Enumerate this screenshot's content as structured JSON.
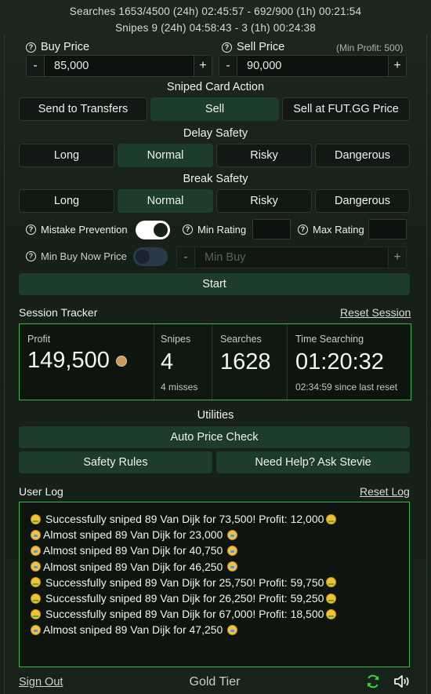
{
  "status": {
    "searches_line": "Searches  1653/4500 (24h) 02:45:57  -  692/900 (1h) 00:21:54",
    "snipes_line": "Snipes  9 (24h) 04:58:43  -  3 (1h) 00:24:38"
  },
  "buy": {
    "label": "Buy Price",
    "value": "85,000",
    "minus": "-",
    "plus": "+"
  },
  "sell": {
    "label": "Sell Price",
    "value": "90,000",
    "minus": "-",
    "plus": "+",
    "min_profit": "(Min Profit: 500)"
  },
  "sniped_action": {
    "title": "Sniped Card Action",
    "options": [
      "Send to Transfers",
      "Sell",
      "Sell at FUT.GG Price"
    ],
    "selected": "Sell"
  },
  "delay_safety": {
    "title": "Delay Safety",
    "options": [
      "Long",
      "Normal",
      "Risky",
      "Dangerous"
    ],
    "selected": "Normal"
  },
  "break_safety": {
    "title": "Break Safety",
    "options": [
      "Long",
      "Normal",
      "Risky",
      "Dangerous"
    ],
    "selected": "Normal"
  },
  "mistake_prevention": {
    "label": "Mistake Prevention",
    "enabled": true
  },
  "min_rating": {
    "label": "Min Rating",
    "value": ""
  },
  "max_rating": {
    "label": "Max Rating",
    "value": ""
  },
  "min_buy_now": {
    "label": "Min Buy Now Price",
    "enabled": false,
    "placeholder": "Min Buy",
    "minus": "-",
    "plus": "+"
  },
  "start_label": "Start",
  "session": {
    "title": "Session Tracker",
    "reset": "Reset Session",
    "profit_caption": "Profit",
    "profit_value": "149,500",
    "snipes_caption": "Snipes",
    "snipes_value": "4",
    "snipes_sub": "4 misses",
    "searches_caption": "Searches",
    "searches_value": "1628",
    "time_caption": "Time Searching",
    "time_value": "01:20:32",
    "time_sub": "02:34:59 since last reset"
  },
  "utilities": {
    "title": "Utilities",
    "auto_price": "Auto Price Check",
    "safety_rules": "Safety Rules",
    "help": "Need Help? Ask Stevie"
  },
  "user_log": {
    "title": "User Log",
    "reset": "Reset Log",
    "entries": [
      {
        "icon": "money-face-icon",
        "text": "Successfully sniped 89 Van Dijk for 73,500! Profit: 12,000",
        "trail": "money-face-icon"
      },
      {
        "icon": "sad-face-icon",
        "text": "Almost sniped 89 Van Dijk for 23,000",
        "trail": "sad-face-icon"
      },
      {
        "icon": "sad-face-icon",
        "text": "Almost sniped 89 Van Dijk for 40,750",
        "trail": "sad-face-icon"
      },
      {
        "icon": "sad-face-icon",
        "text": "Almost sniped 89 Van Dijk for 46,250",
        "trail": "sad-face-icon"
      },
      {
        "icon": "money-face-icon",
        "text": "Successfully sniped 89 Van Dijk for 25,750! Profit: 59,750",
        "trail": "money-face-icon"
      },
      {
        "icon": "money-face-icon",
        "text": "Successfully sniped 89 Van Dijk for 26,250! Profit: 59,250",
        "trail": "money-face-icon"
      },
      {
        "icon": "money-face-icon",
        "text": "Successfully sniped 89 Van Dijk for 67,000! Profit: 18,500",
        "trail": "money-face-icon"
      },
      {
        "icon": "sad-face-icon",
        "text": "Almost sniped 89 Van Dijk for 47,250",
        "trail": "sad-face-icon"
      }
    ]
  },
  "footer": {
    "sign_out": "Sign Out",
    "tier": "Gold Tier"
  },
  "colors": {
    "accent_green": "#1e3c2a",
    "border_green": "#3fb344",
    "background": "#171d18"
  }
}
